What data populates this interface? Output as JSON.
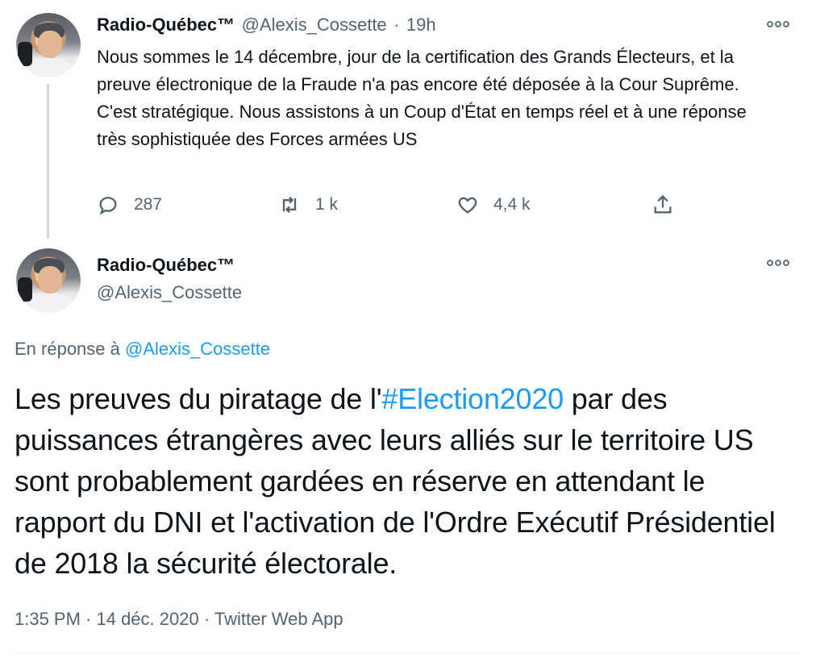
{
  "first_tweet": {
    "display_name": "Radio-Québec™",
    "handle": "@Alexis_Cossette",
    "separator": "·",
    "time": "19h",
    "text": "Nous sommes le 14 décembre, jour de la certification des Grands Électeurs, et la preuve électronique de la Fraude n'a pas encore été déposée à la Cour Suprême. C'est stratégique. Nous assistons à un Coup d'État en temps réel et à une réponse très sophistiquée des Forces armées US",
    "actions": {
      "reply_count": "287",
      "retweet_count": "1 k",
      "like_count": "4,4 k"
    }
  },
  "main_tweet": {
    "display_name": "Radio-Québec™",
    "handle": "@Alexis_Cossette",
    "reply_prefix": "En réponse à",
    "reply_to": "@Alexis_Cossette",
    "text_before": "Les preuves du piratage de l'",
    "hashtag": "#Election2020",
    "text_after": " par des puissances étrangères avec leurs alliés sur le territoire US sont probablement gardées en réserve en attendant le rapport du DNI et l'activation de l'Ordre Exécutif Présidentiel de 2018 la sécurité électorale.",
    "timestamp": "1:35 PM · 14 déc. 2020 · Twitter Web App"
  },
  "icons": {
    "more": "more-horizontal-icon",
    "reply": "reply-icon",
    "retweet": "retweet-icon",
    "like": "like-icon",
    "share": "share-icon"
  },
  "colors": {
    "link": "#1d9bf0",
    "muted": "#536471",
    "text": "#0f1419"
  }
}
